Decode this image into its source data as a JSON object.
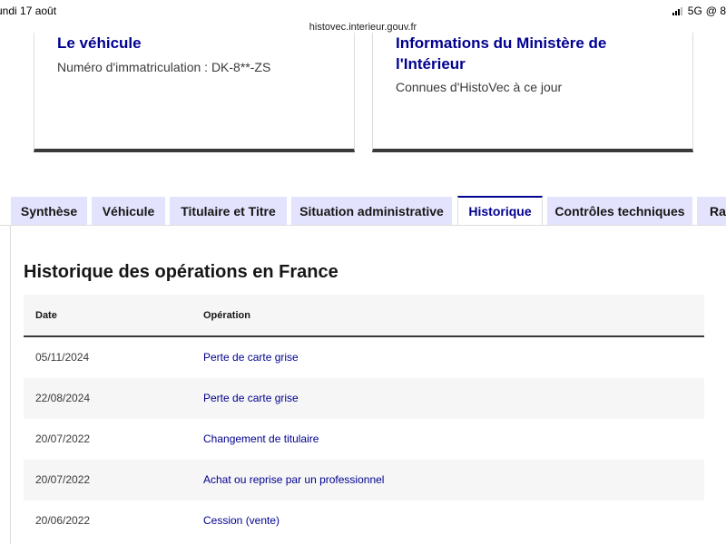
{
  "status_bar": {
    "time": "undi 17 août",
    "network": "5G",
    "extra": "@ 8"
  },
  "browser": {
    "url": "histovec.interieur.gouv.fr"
  },
  "cards": {
    "vehicle": {
      "title": "Le véhicule",
      "text": "Numéro d'immatriculation : DK-8**-ZS"
    },
    "ministry": {
      "title": "Informations du Ministère de l'Intérieur",
      "text": "Connues d'HistoVec à ce jour"
    }
  },
  "tabs": [
    {
      "label": "Synthèse",
      "active": false
    },
    {
      "label": "Véhicule",
      "active": false
    },
    {
      "label": "Titulaire et Titre",
      "active": false
    },
    {
      "label": "Situation administrative",
      "active": false
    },
    {
      "label": "Historique",
      "active": true
    },
    {
      "label": "Contrôles techniques",
      "active": false
    },
    {
      "label": "Rap",
      "active": false
    }
  ],
  "panel": {
    "title": "Historique des opérations en France",
    "table": {
      "headers": [
        "Date",
        "Opération"
      ],
      "rows": [
        {
          "date": "05/11/2024",
          "operation": "Perte de carte grise"
        },
        {
          "date": "22/08/2024",
          "operation": "Perte de carte grise"
        },
        {
          "date": "20/07/2022",
          "operation": "Changement de titulaire"
        },
        {
          "date": "20/07/2022",
          "operation": "Achat ou reprise par un professionnel"
        },
        {
          "date": "20/06/2022",
          "operation": "Cession (vente)"
        }
      ]
    }
  },
  "colors": {
    "accent": "#000091",
    "tab_bg": "#e3e3fd",
    "row_alt": "#f6f6f6"
  }
}
